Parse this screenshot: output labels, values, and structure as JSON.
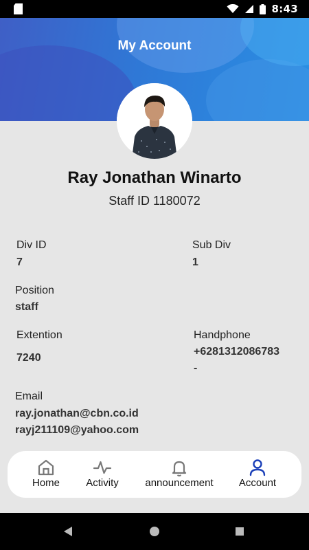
{
  "status_bar": {
    "time": "8:43",
    "icons": [
      "sd-card-icon",
      "wifi-icon",
      "signal-icon",
      "battery-icon"
    ]
  },
  "header": {
    "title": "My Account"
  },
  "profile": {
    "name": "Ray Jonathan Winarto",
    "staff_id": "Staff ID 1180072"
  },
  "fields": {
    "div_id": {
      "label": "Div ID",
      "value": "7"
    },
    "sub_div": {
      "label": "Sub Div",
      "value": "1"
    },
    "position": {
      "label": "Position",
      "value": "staff"
    },
    "extention": {
      "label": "Extention",
      "value": "7240"
    },
    "handphone": {
      "label": "Handphone",
      "value": "+6281312086783",
      "value2": "-"
    },
    "email": {
      "label": "Email",
      "value": "ray.jonathan@cbn.co.id",
      "value2": "rayj211109@yahoo.com"
    }
  },
  "nav": {
    "home": "Home",
    "activity": "Activity",
    "announcement": "announcement",
    "account": "Account",
    "active_color": "#1a3fb8"
  }
}
